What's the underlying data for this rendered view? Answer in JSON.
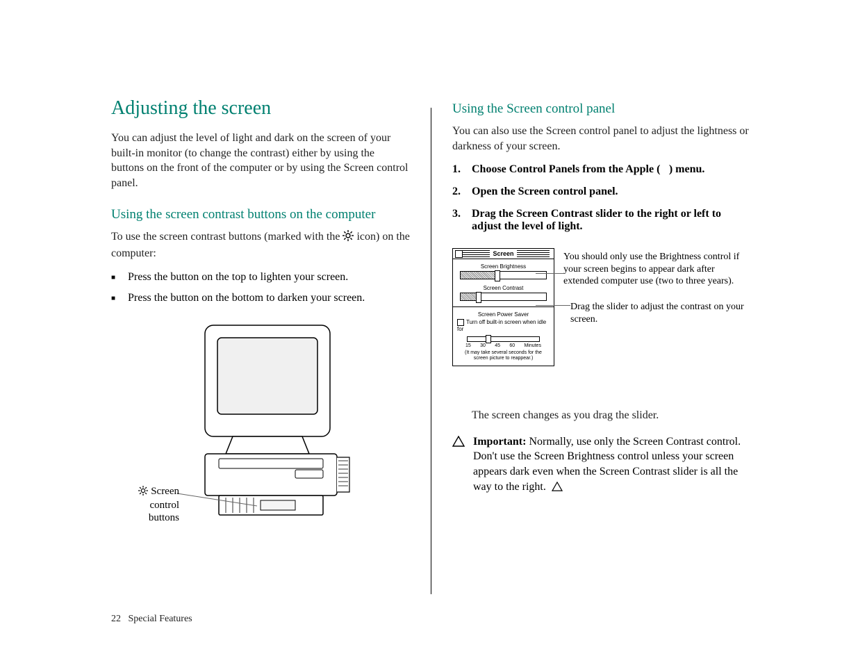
{
  "left": {
    "h1": "Adjusting the screen",
    "intro": "You can adjust the level of light and dark on the screen of your built-in monitor (to change the contrast) either by using the buttons on the front of the computer or by using the Screen control panel.",
    "h2": "Using the screen contrast buttons on the computer",
    "lead_a": "To use the screen contrast buttons (marked with the ",
    "lead_b": " icon) on the computer:",
    "bullets": [
      "Press the button on the top to lighten your screen.",
      "Press the button on the bottom to darken your screen."
    ],
    "fig_label": " Screen control buttons"
  },
  "right": {
    "h2": "Using the Screen control panel",
    "intro": "You can also use the Screen control panel to adjust the lightness or darkness of your screen.",
    "steps": [
      "Choose Control Panels from the Apple () menu.",
      "Open the Screen control panel.",
      "Drag the Screen Contrast slider to the right or left to adjust the level of light."
    ],
    "panel": {
      "title": "Screen",
      "brightness_label": "Screen Brightness",
      "contrast_label": "Screen Contrast",
      "saver_label": "Screen Power Saver",
      "saver_check": "Turn off built-in screen when idle for",
      "scale": [
        "15",
        "30",
        "45",
        "60",
        "Minutes"
      ],
      "note": "(It may take several seconds for the screen picture to reappear.)"
    },
    "callout_a": "You should only use the Brightness control if your screen begins to appear dark after extended computer use (two to three years).",
    "callout_b": "Drag the slider to adjust the contrast on your screen.",
    "after_panel": "The screen changes as you drag the slider.",
    "important_label": "Important:",
    "important_body": "  Normally, use only the Screen Contrast control. Don't use the Screen Brightness control unless your screen appears dark even when the Screen Contrast slider is all the way to the right.  "
  },
  "footer": {
    "page": "22",
    "section": "Special Features"
  }
}
